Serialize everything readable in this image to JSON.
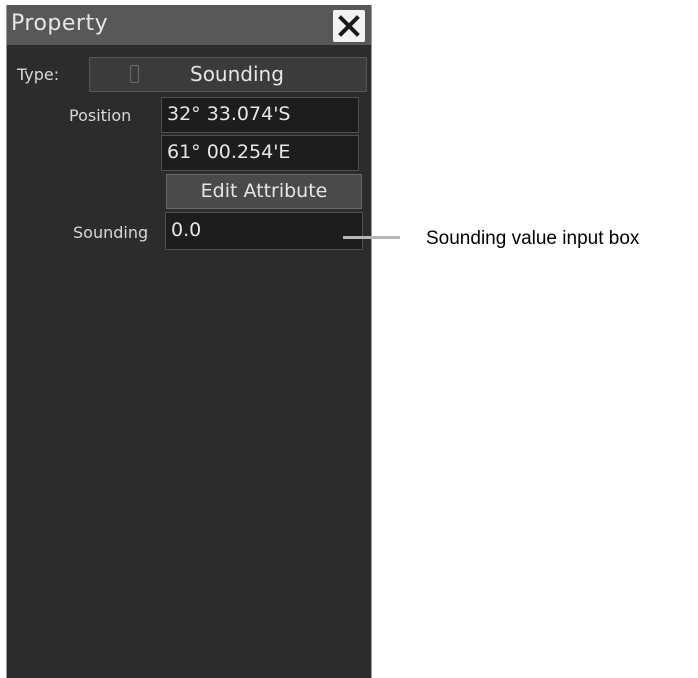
{
  "window": {
    "title": "Property",
    "close_icon": "close-icon"
  },
  "type": {
    "label": "Type:",
    "value": "Sounding"
  },
  "position": {
    "label": "Position",
    "latitude": "32°  33.074'S",
    "longitude": "61°  00.254'E"
  },
  "edit_attribute": {
    "label": "Edit Attribute"
  },
  "sounding": {
    "label": "Sounding",
    "value": "0.0"
  },
  "annotation": {
    "text": "Sounding value input box"
  },
  "colors": {
    "panel_bg": "#2c2c2c",
    "titlebar_bg": "#585858",
    "field_bg": "#1d1d1d",
    "button_bg": "#4a4a4a",
    "text": "#e6e6e6"
  }
}
